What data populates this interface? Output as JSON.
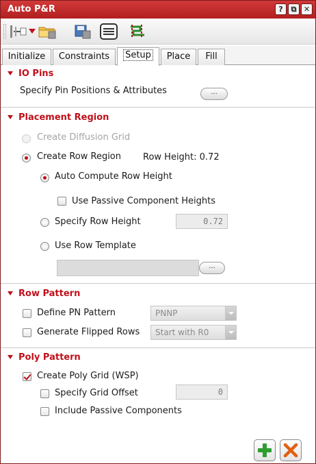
{
  "window": {
    "title": "Auto P&R",
    "buttons": [
      {
        "name": "help-icon",
        "glyph": "?"
      },
      {
        "name": "float-icon",
        "glyph": "⧉"
      },
      {
        "name": "close-icon",
        "glyph": "✕"
      }
    ]
  },
  "toolbar": {
    "items": [
      "pin-tool-icon",
      "dropdown-arrow-icon",
      "open-folder-icon",
      "save-icon",
      "list-menu-icon",
      "route-tool-icon"
    ]
  },
  "tabs": [
    {
      "label": "Initialize",
      "active": false
    },
    {
      "label": "Constraints",
      "active": false
    },
    {
      "label": "Setup",
      "active": true
    },
    {
      "label": "Place",
      "active": false
    },
    {
      "label": "Fill",
      "active": false
    }
  ],
  "io_pins": {
    "title": "IO Pins",
    "specify_label": "Specify Pin Positions & Attributes",
    "ellipsis": "..."
  },
  "placement_region": {
    "title": "Placement Region",
    "create_diffusion_grid": "Create Diffusion Grid",
    "create_row_region": "Create Row Region",
    "row_height_text": "Row Height: 0.72",
    "auto_compute": "Auto Compute Row Height",
    "use_passive": "Use Passive Component Heights",
    "specify_row_height": "Specify Row Height",
    "row_height_value": "0.72",
    "use_row_template": "Use Row Template",
    "template_value": "",
    "template_ellipsis": "..."
  },
  "row_pattern": {
    "title": "Row Pattern",
    "define_pn": "Define PN Pattern",
    "pn_value": "PNNP",
    "generate_flipped": "Generate Flipped Rows",
    "flipped_value": "Start with R0"
  },
  "poly_pattern": {
    "title": "Poly Pattern",
    "create_poly_grid": "Create Poly Grid (WSP)",
    "specify_grid_offset": "Specify Grid Offset",
    "grid_offset_value": "0",
    "include_passive": "Include Passive Components"
  },
  "colors": {
    "accent": "#c0101a",
    "titlebar": "#c42a2a",
    "add_green": "#2e9e2e",
    "cancel_orange": "#e06010"
  }
}
